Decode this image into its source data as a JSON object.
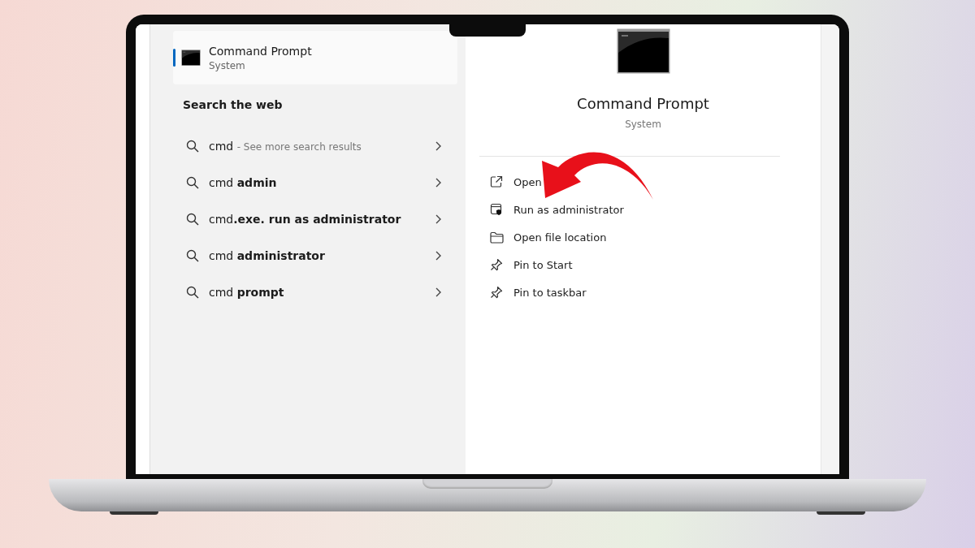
{
  "best_match": {
    "title": "Command Prompt",
    "subtitle": "System",
    "selected": true
  },
  "web_section": {
    "heading": "Search the web"
  },
  "web_results": [
    {
      "query": "cmd",
      "hint": "- See more search results"
    },
    {
      "query": "cmd **admin**"
    },
    {
      "query": "cmd**.exe. run as administrator**"
    },
    {
      "query": "cmd **administrator**"
    },
    {
      "query": "cmd **prompt**"
    }
  ],
  "details": {
    "title": "Command Prompt",
    "subtitle": "System"
  },
  "actions": [
    {
      "kind": "open",
      "label": "Open"
    },
    {
      "kind": "admin",
      "label": "Run as administrator"
    },
    {
      "kind": "folder",
      "label": "Open file location"
    },
    {
      "kind": "pin",
      "label": "Pin to Start"
    },
    {
      "kind": "pin",
      "label": "Pin to taskbar"
    }
  ]
}
